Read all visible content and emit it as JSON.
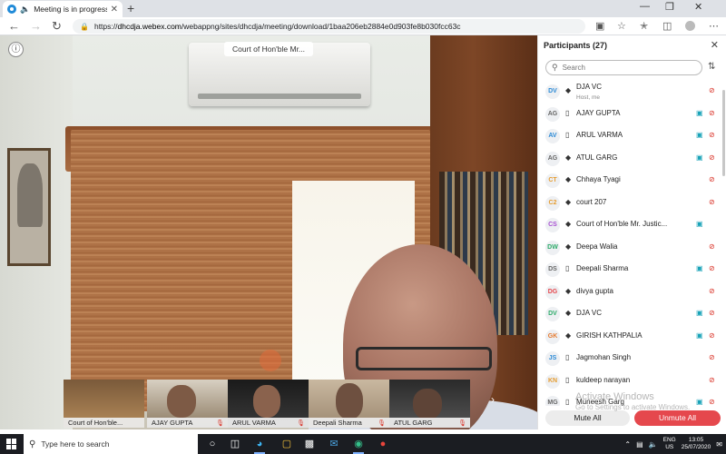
{
  "browser": {
    "tab_title": "Meeting is in progress...",
    "url_prefix": "https://",
    "url_host": "dhcdja.webex.com",
    "url_path": "/webappng/sites/dhcdja/meeting/download/1baa206eb2884e0d903fe8b030fcc63c"
  },
  "video": {
    "active_speaker_label": "Court of Hon'ble Mr...",
    "thumbnails": [
      {
        "name": "Court of Hon'ble..."
      },
      {
        "name": "AJAY GUPTA"
      },
      {
        "name": "ARUL VARMA"
      },
      {
        "name": "Deepali Sharma"
      },
      {
        "name": "ATUL GARG"
      }
    ]
  },
  "participants": {
    "title": "Participants (27)",
    "search_placeholder": "Search",
    "items": [
      {
        "initials": "DV",
        "name": "DJA VC",
        "sub": "Host, me",
        "device": "web",
        "camera": false,
        "mic_muted": true,
        "color": "#2b8ad6"
      },
      {
        "initials": "AG",
        "name": "AJAY GUPTA",
        "sub": "",
        "device": "phone",
        "camera": true,
        "mic_muted": true,
        "color": "#666666"
      },
      {
        "initials": "AV",
        "name": "ARUL VARMA",
        "sub": "",
        "device": "phone",
        "camera": true,
        "mic_muted": true,
        "color": "#2b8ad6"
      },
      {
        "initials": "AG",
        "name": "ATUL GARG",
        "sub": "",
        "device": "web",
        "camera": true,
        "mic_muted": true,
        "color": "#666666"
      },
      {
        "initials": "CT",
        "name": "Chhaya Tyagi",
        "sub": "",
        "device": "web",
        "camera": false,
        "mic_muted": true,
        "color": "#e59b2e"
      },
      {
        "initials": "C2",
        "name": "court 207",
        "sub": "",
        "device": "web",
        "camera": false,
        "mic_muted": true,
        "color": "#e59b2e"
      },
      {
        "initials": "CS",
        "name": "Court of Hon'ble Mr. Justic...",
        "sub": "",
        "device": "web",
        "camera": true,
        "mic_muted": false,
        "color": "#a64ed1"
      },
      {
        "initials": "DW",
        "name": "Deepa Walia",
        "sub": "",
        "device": "web",
        "camera": false,
        "mic_muted": true,
        "color": "#2eab6a"
      },
      {
        "initials": "DS",
        "name": "Deepali Sharma",
        "sub": "",
        "device": "phone",
        "camera": true,
        "mic_muted": true,
        "color": "#666666"
      },
      {
        "initials": "DG",
        "name": "divya gupta",
        "sub": "",
        "device": "web",
        "camera": false,
        "mic_muted": true,
        "color": "#e5484d"
      },
      {
        "initials": "DV",
        "name": "DJA VC",
        "sub": "",
        "device": "web",
        "camera": true,
        "mic_muted": true,
        "color": "#2eab6a"
      },
      {
        "initials": "GK",
        "name": "GIRISH KATHPALIA",
        "sub": "",
        "device": "web",
        "camera": true,
        "mic_muted": true,
        "color": "#e57a2e"
      },
      {
        "initials": "JS",
        "name": "Jagmohan Singh",
        "sub": "",
        "device": "phone",
        "camera": false,
        "mic_muted": true,
        "color": "#2b8ad6"
      },
      {
        "initials": "KN",
        "name": "kuldeep narayan",
        "sub": "",
        "device": "phone",
        "camera": false,
        "mic_muted": true,
        "color": "#e59b2e"
      },
      {
        "initials": "MG",
        "name": "Muneesh Garg",
        "sub": "",
        "device": "phone",
        "camera": true,
        "mic_muted": true,
        "color": "#666666"
      }
    ],
    "mute_all_label": "Mute All",
    "unmute_all_label": "Unmute All"
  },
  "watermark": {
    "line1": "Activate Windows",
    "line2": "Go to Settings to activate Windows."
  },
  "taskbar": {
    "search_placeholder": "Type here to search",
    "lang_line1": "ENG",
    "lang_line2": "US",
    "time": "13:05",
    "date": "25/07/2020"
  },
  "colors": {
    "accent_teal": "#1aa3b8",
    "muted_red": "#d93025",
    "unmute_button": "#e5484d"
  }
}
